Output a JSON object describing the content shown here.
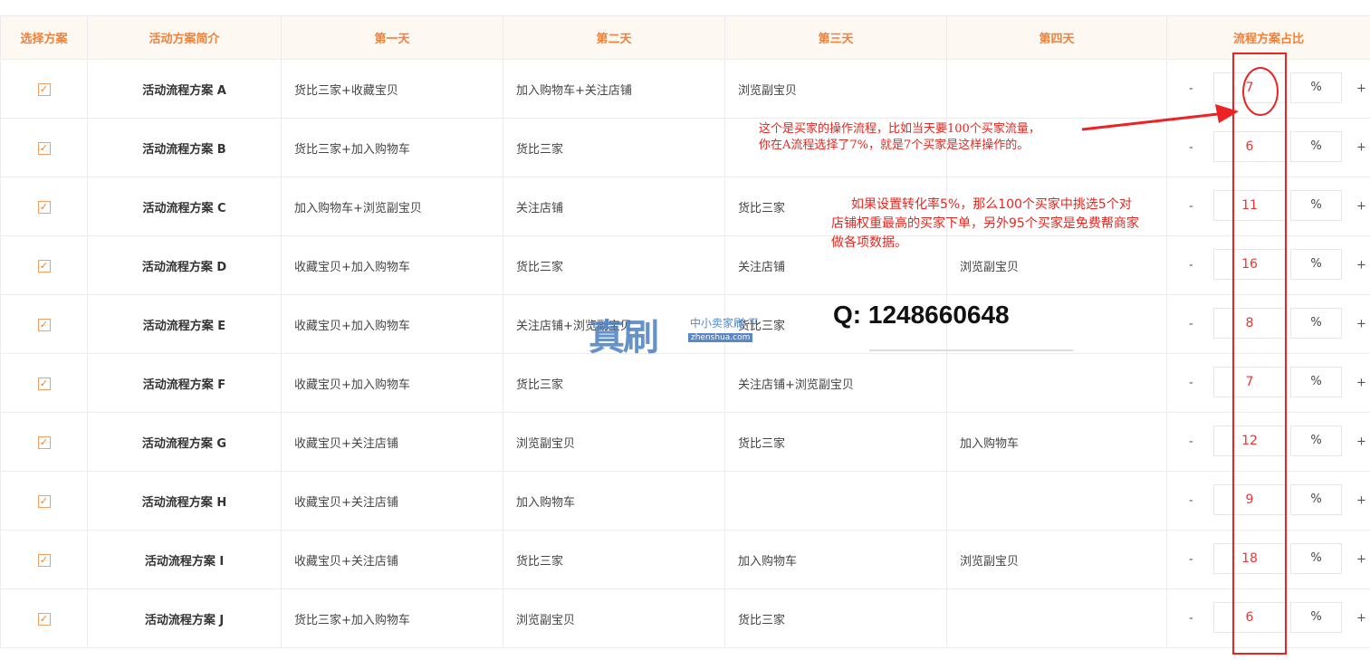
{
  "headers": [
    "选择方案",
    "活动方案简介",
    "第一天",
    "第二天",
    "第三天",
    "第四天",
    "流程方案占比"
  ],
  "rows": [
    {
      "checked": true,
      "name": "活动流程方案 A",
      "d1": "货比三家+收藏宝贝",
      "d2": "加入购物车+关注店铺",
      "d3": "浏览副宝贝",
      "d4": "",
      "ratio": "7"
    },
    {
      "checked": true,
      "name": "活动流程方案 B",
      "d1": "货比三家+加入购物车",
      "d2": "货比三家",
      "d3": "",
      "d4": "",
      "ratio": "6"
    },
    {
      "checked": true,
      "name": "活动流程方案 C",
      "d1": "加入购物车+浏览副宝贝",
      "d2": "关注店铺",
      "d3": "货比三家",
      "d4": "",
      "ratio": "11"
    },
    {
      "checked": true,
      "name": "活动流程方案 D",
      "d1": "收藏宝贝+加入购物车",
      "d2": "货比三家",
      "d3": "关注店铺",
      "d4": "浏览副宝贝",
      "ratio": "16"
    },
    {
      "checked": true,
      "name": "活动流程方案 E",
      "d1": "收藏宝贝+加入购物车",
      "d2": "关注店铺+浏览副宝贝",
      "d3": "货比三家",
      "d4": "",
      "ratio": "8"
    },
    {
      "checked": true,
      "name": "活动流程方案 F",
      "d1": "收藏宝贝+加入购物车",
      "d2": "货比三家",
      "d3": "关注店铺+浏览副宝贝",
      "d4": "",
      "ratio": "7"
    },
    {
      "checked": true,
      "name": "活动流程方案 G",
      "d1": "收藏宝贝+关注店铺",
      "d2": "浏览副宝贝",
      "d3": "货比三家",
      "d4": "加入购物车",
      "ratio": "12"
    },
    {
      "checked": true,
      "name": "活动流程方案 H",
      "d1": "收藏宝贝+关注店铺",
      "d2": "加入购物车",
      "d3": "",
      "d4": "",
      "ratio": "9"
    },
    {
      "checked": true,
      "name": "活动流程方案 I",
      "d1": "收藏宝贝+关注店铺",
      "d2": "货比三家",
      "d3": "加入购物车",
      "d4": "浏览副宝贝",
      "ratio": "18"
    },
    {
      "checked": true,
      "name": "活动流程方案 J",
      "d1": "货比三家+加入购物车",
      "d2": "浏览副宝贝",
      "d3": "货比三家",
      "d4": "",
      "ratio": "6"
    }
  ],
  "controls": {
    "minus": "-",
    "plus": "+",
    "percent": "%",
    "check": "✓"
  },
  "annotations": {
    "note1_line1": "这个是买家的操作流程，比如当天要100个买家流量，",
    "note1_line2": "你在A流程选择了7%，就是7个买家是这样操作的。",
    "note2": "如果设置转化率5%，那么100个买家中挑选5个对店铺权重最高的买家下单，另外95个买家是免费帮商家做各项数据。"
  },
  "watermark": {
    "logo": "真刷",
    "tagline": "中小卖家刷 平",
    "domain": "zhenshua.com",
    "qq": "Q: 1248660648"
  },
  "colors": {
    "header_text": "#f0813a",
    "annotation": "#e8261f",
    "watermark": "#3d74bf"
  }
}
